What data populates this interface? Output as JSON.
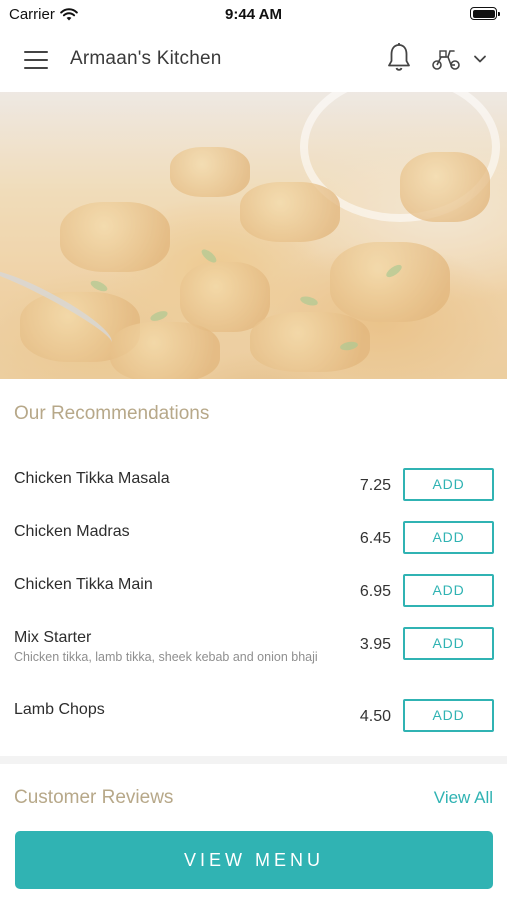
{
  "status_bar": {
    "carrier": "Carrier",
    "time": "9:44 AM"
  },
  "nav": {
    "title": "Armaan's Kitchen",
    "icons": [
      "menu-icon",
      "bell-icon",
      "scooter-icon",
      "chevron-down-icon"
    ]
  },
  "recommendations": {
    "title": "Our Recommendations",
    "items": [
      {
        "name": "Chicken Tikka Masala",
        "description": "",
        "price": "7.25",
        "button": "ADD"
      },
      {
        "name": "Chicken Madras",
        "description": "",
        "price": "6.45",
        "button": "ADD"
      },
      {
        "name": "Chicken Tikka Main",
        "description": "",
        "price": "6.95",
        "button": "ADD"
      },
      {
        "name": "Mix Starter",
        "description": "Chicken tikka, lamb tikka, sheek kebab and onion bhaji",
        "price": "3.95",
        "button": "ADD"
      },
      {
        "name": "Lamb Chops",
        "description": "",
        "price": "4.50",
        "button": "ADD"
      }
    ]
  },
  "reviews": {
    "title": "Customer Reviews",
    "view_all": "View All"
  },
  "footer": {
    "view_menu": "VIEW MENU"
  },
  "colors": {
    "accent": "#30b3b3",
    "section_title": "#b7a889",
    "text": "#2d2d2d"
  }
}
